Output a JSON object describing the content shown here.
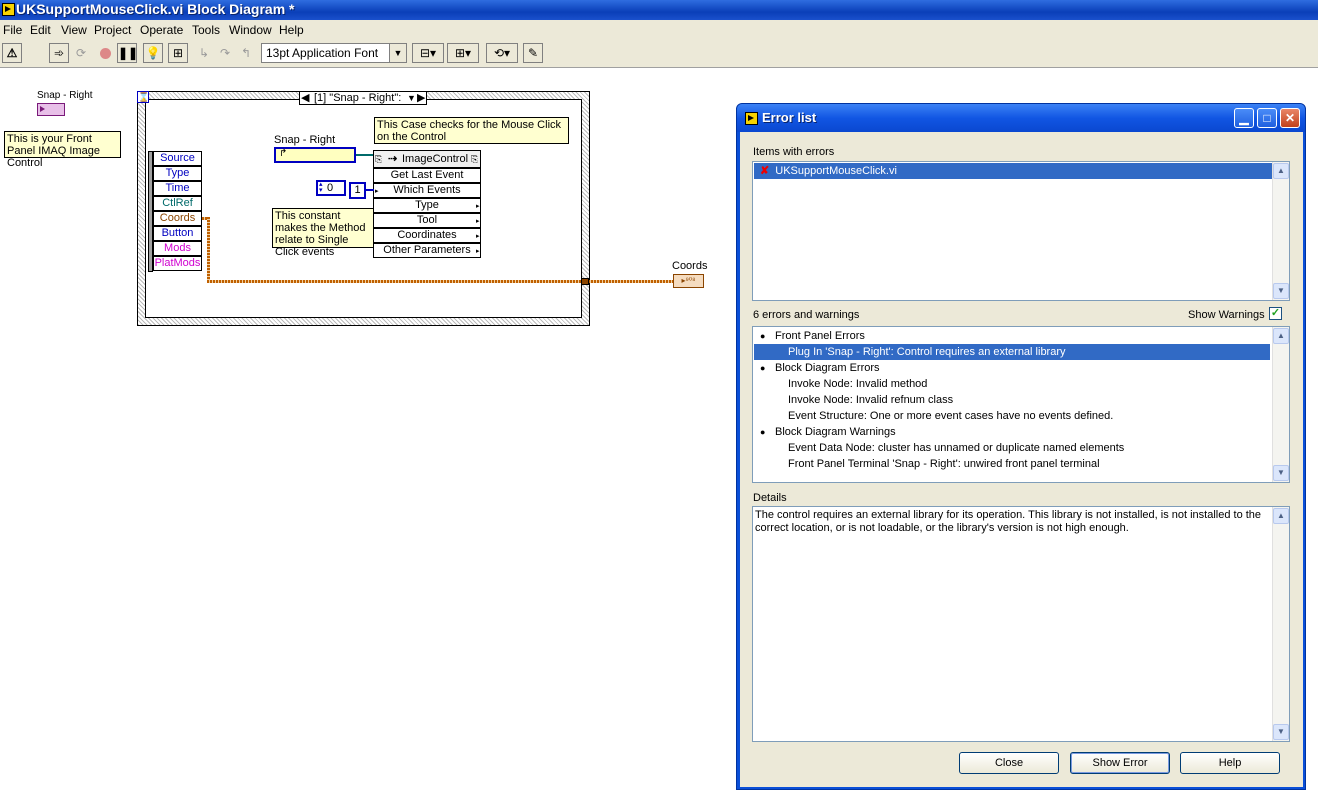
{
  "window": {
    "title": "UKSupportMouseClick.vi Block Diagram *"
  },
  "menu": [
    "File",
    "Edit",
    "View",
    "Project",
    "Operate",
    "Tools",
    "Window",
    "Help"
  ],
  "toolbar": {
    "font": "13pt Application Font"
  },
  "diagram": {
    "terminal_label": "Snap - Right",
    "comment_front_panel": "This is your Front Panel IMAQ Image Control",
    "event_case": "[1] \"Snap - Right\":",
    "event_data": [
      "Source",
      "Type",
      "Time",
      "CtlRef",
      "Coords",
      "Button",
      "Mods",
      "PlatMods"
    ],
    "inner_terminal_label": "Snap - Right",
    "comment_case": "This Case checks for the Mouse Click on the Control",
    "node_title": "ImageControl",
    "node_rows": [
      "Get Last Event",
      "Which Events",
      "Type",
      "Tool",
      "Coordinates",
      "Other Parameters"
    ],
    "const_zero": "0",
    "const_one": "1",
    "comment_constant": "This constant makes the Method relate to Single Click events",
    "coords_label": "Coords"
  },
  "error_dialog": {
    "title": "Error list",
    "items_label": "Items with errors",
    "items": [
      "UKSupportMouseClick.vi"
    ],
    "count_label": "6 errors and warnings",
    "show_warnings": "Show Warnings",
    "errors": [
      {
        "text": "Front Panel Errors",
        "level": 0
      },
      {
        "text": "Plug In 'Snap - Right': Control requires an external library",
        "level": 1
      },
      {
        "text": "Block Diagram Errors",
        "level": 0
      },
      {
        "text": "Invoke Node: Invalid method",
        "level": 1
      },
      {
        "text": "Invoke Node: Invalid refnum class",
        "level": 1
      },
      {
        "text": "Event Structure: One or more event cases have no events defined.",
        "level": 1
      },
      {
        "text": "Block Diagram Warnings",
        "level": 0
      },
      {
        "text": "Event Data Node: cluster has unnamed or duplicate named elements",
        "level": 1
      },
      {
        "text": "Front Panel Terminal 'Snap - Right': unwired front panel terminal",
        "level": 1
      }
    ],
    "details_label": "Details",
    "details": "The control requires an external library for its operation. This library is not installed, is not installed to the correct location, or is not loadable, or the library's version is not high enough.",
    "buttons": {
      "close": "Close",
      "show_error": "Show Error",
      "help": "Help"
    }
  }
}
